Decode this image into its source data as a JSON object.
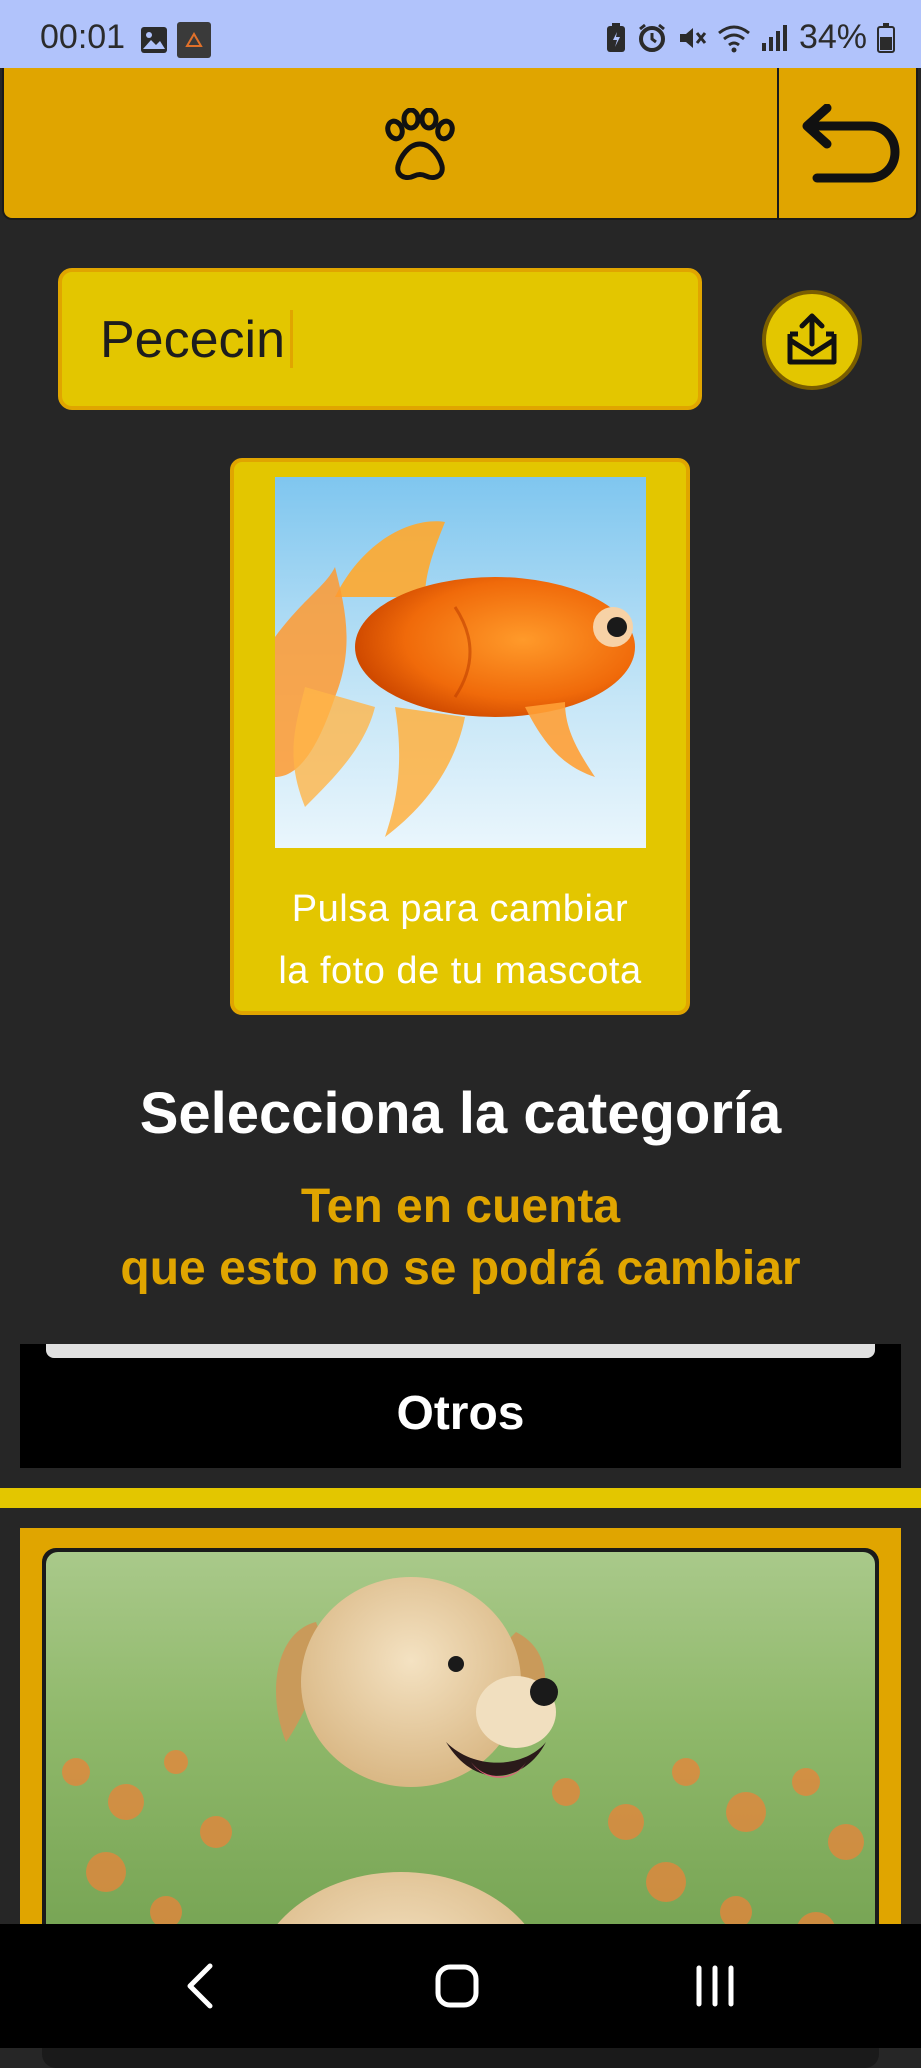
{
  "status_bar": {
    "time": "00:01",
    "battery": "34%",
    "icons": [
      "gallery-icon",
      "app-notification-icon",
      "battery-saver-icon",
      "alarm-icon",
      "mute-icon",
      "wifi-icon",
      "signal-icon",
      "battery-icon"
    ]
  },
  "app_bar": {
    "icon": "paw-icon",
    "back_icon": "back-arrow-icon",
    "color": "#e0a500"
  },
  "pet_form": {
    "name_value": "Pececin",
    "upload_icon": "upload-mail-icon",
    "photo_caption_line1": "Pulsa para cambiar",
    "photo_caption_line2": "la foto de tu mascota"
  },
  "category": {
    "title": "Selecciona la categoría",
    "warning_line1": "Ten en cuenta",
    "warning_line2": "que esto no se podrá cambiar",
    "selected": "Otros"
  },
  "nav": {
    "back_icon": "nav-back-icon",
    "home_icon": "nav-home-icon",
    "recents_icon": "nav-recents-icon"
  },
  "colors": {
    "accent": "#e0a500",
    "field": "#e3c600",
    "background": "#262626"
  }
}
